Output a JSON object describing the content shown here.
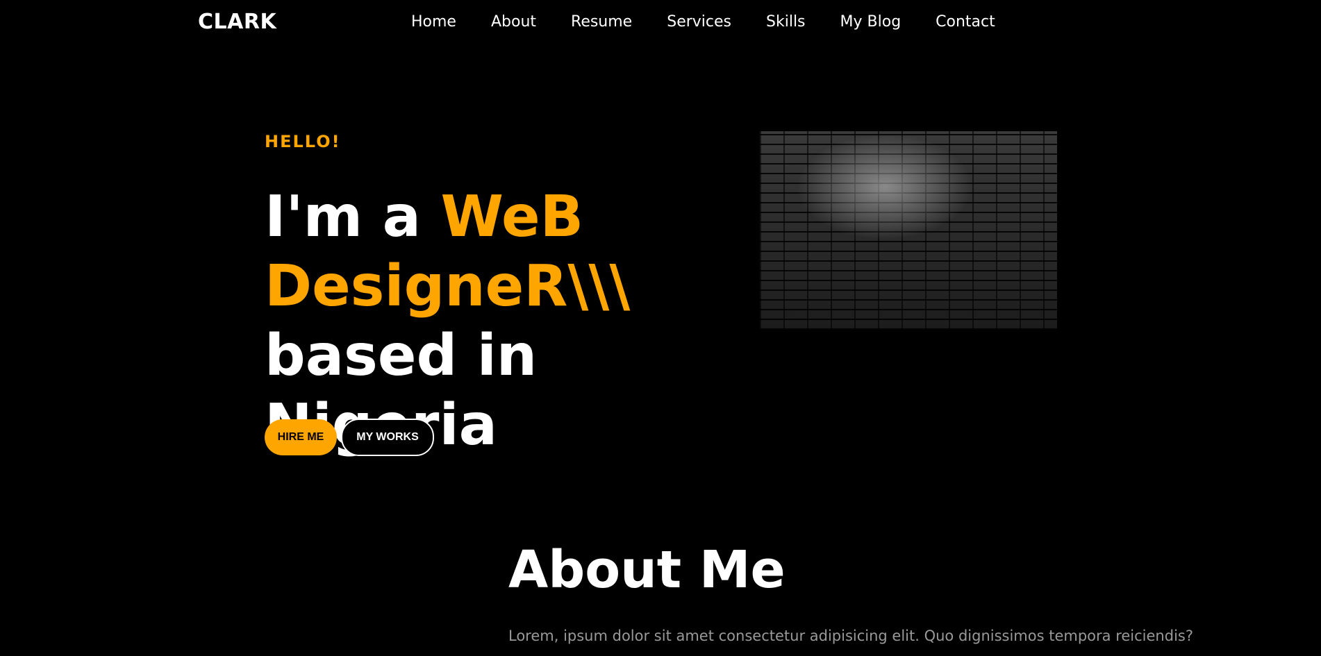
{
  "brand": {
    "logo": "CLARK",
    "accent_color": "#ffa500"
  },
  "nav": {
    "items": [
      {
        "label": "Home"
      },
      {
        "label": "About"
      },
      {
        "label": "Resume"
      },
      {
        "label": "Services"
      },
      {
        "label": "Skills"
      },
      {
        "label": "My Blog"
      },
      {
        "label": "Contact"
      }
    ]
  },
  "hero": {
    "greeting": "HELLO!",
    "headline_prefix": "I'm a ",
    "headline_accent": "WeB DesigneR\\\\\\",
    "headline_suffix": " based in Nigeria",
    "image_alt": "dark brick wall with spotlight",
    "buttons": {
      "hire": "HIRE ME",
      "works": "MY WORKS"
    }
  },
  "about": {
    "title": "About Me",
    "text": "Lorem, ipsum dolor sit amet consectetur adipisicing elit. Quo dignissimos tempora reiciendis?"
  }
}
